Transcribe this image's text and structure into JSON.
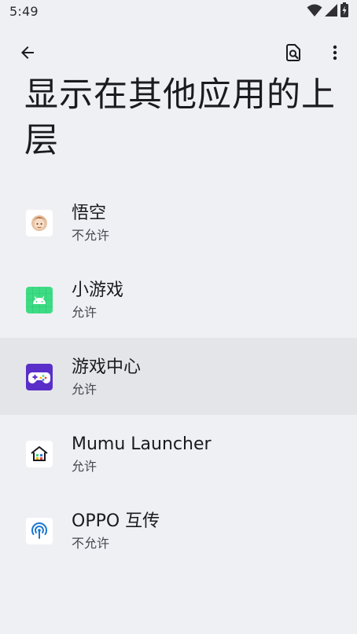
{
  "status_bar": {
    "time": "5:49",
    "icons": [
      "wifi-icon",
      "signal-icon",
      "battery-charging-icon"
    ]
  },
  "toolbar": {
    "back_icon": "arrow-back-icon",
    "search_icon": "search-settings-icon",
    "more_icon": "more-vert-icon"
  },
  "page": {
    "title": "显示在其他应用的上层"
  },
  "apps": [
    {
      "name": "悟空",
      "status": "不允许",
      "icon": "wukong-app-icon"
    },
    {
      "name": "小游戏",
      "status": "允许",
      "icon": "android-app-icon"
    },
    {
      "name": "游戏中心",
      "status": "允许",
      "icon": "gamepad-app-icon"
    },
    {
      "name": "Mumu Launcher",
      "status": "允许",
      "icon": "home-launcher-icon"
    },
    {
      "name": "OPPO 互传",
      "status": "不允许",
      "icon": "wireless-share-icon"
    }
  ],
  "colors": {
    "background": "#eff0f4",
    "highlight_row": "#e4e5e9",
    "android_green": "#3ddc84",
    "gamepad_purple": "#5a2fc9",
    "oppo_blue": "#1976d2"
  }
}
